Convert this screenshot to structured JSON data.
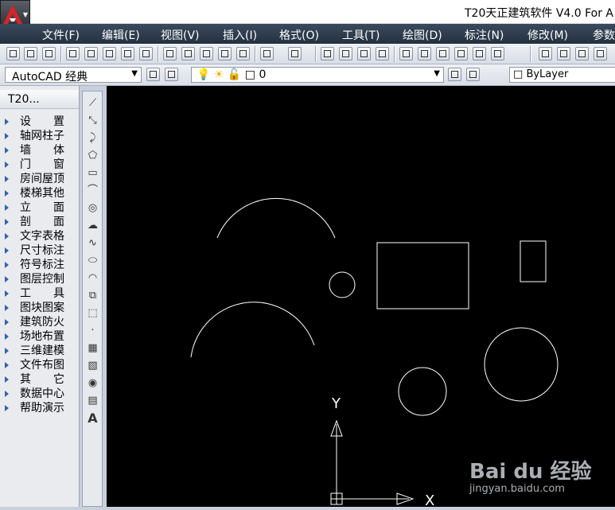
{
  "window": {
    "title": "T20天正建筑软件 V4.0 For A"
  },
  "menu": [
    "文件(F)",
    "编辑(E)",
    "视图(V)",
    "插入(I)",
    "格式(O)",
    "工具(T)",
    "绘图(D)",
    "标注(N)",
    "修改(M)",
    "参数"
  ],
  "workspace": {
    "value": "AutoCAD 经典"
  },
  "layer": {
    "value": "0"
  },
  "linetype": {
    "value": "ByLayer"
  },
  "sidebar": {
    "title": "T20...",
    "items": [
      "设　　置",
      "轴网柱子",
      "墙　　体",
      "门　　窗",
      "房间屋顶",
      "楼梯其他",
      "立　　面",
      "剖　　面",
      "文字表格",
      "尺寸标注",
      "符号标注",
      "图层控制",
      "工　　具",
      "图块图案",
      "建筑防火",
      "场地布置",
      "三维建模",
      "文件布图",
      "其　　它",
      "数据中心",
      "帮助演示"
    ]
  },
  "draw_tools": [
    "line-icon",
    "construction-line-icon",
    "polyline-icon",
    "polygon-icon",
    "rectangle-icon",
    "arc-icon",
    "circle-icon",
    "revision-cloud-icon",
    "spline-icon",
    "ellipse-icon",
    "ellipse-arc-icon",
    "insert-block-icon",
    "make-block-icon",
    "point-icon",
    "hatch-icon",
    "gradient-icon",
    "region-icon",
    "table-icon",
    "multiline-text-icon"
  ],
  "canvas": {
    "axis_y": "Y",
    "axis_x": "X"
  },
  "watermark": {
    "logo": "Bai du 经验",
    "url": "jingyan.baidu.com"
  },
  "colors": {
    "canvas_bg": "#000000",
    "geometry": "#ffffff",
    "menubar": "#2d3a4c"
  }
}
